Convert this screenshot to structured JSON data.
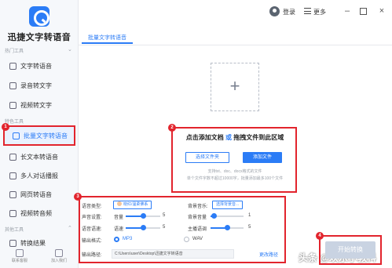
{
  "app": {
    "title": "迅捷文字转语音"
  },
  "sidebar": {
    "sections": [
      {
        "label": "热门工具"
      },
      {
        "label": "特色工具"
      },
      {
        "label": "其他工具"
      }
    ],
    "items": [
      {
        "label": "文字转语音"
      },
      {
        "label": "录音转文字"
      },
      {
        "label": "视频转文字"
      },
      {
        "label": "批量文字转语音"
      },
      {
        "label": "长文本转语音"
      },
      {
        "label": "多人对话播报"
      },
      {
        "label": "网页转语音"
      },
      {
        "label": "视频转音频"
      },
      {
        "label": "转换结果"
      }
    ],
    "badge": "1",
    "bottom": [
      {
        "label": "联系客服"
      },
      {
        "label": "加入我们"
      }
    ]
  },
  "topbar": {
    "login": "登录",
    "more": "更多"
  },
  "tab": {
    "label": "批量文字转语音"
  },
  "upload": {
    "badge": "2",
    "title_part1": "点击添加文档",
    "title_or": "或",
    "title_part2": "拖拽文件到此区域",
    "btn_folder": "选择文件夹",
    "btn_add": "添加文件",
    "hint1": "支持txt、doc、docx格式的文件",
    "hint2": "单个文件字数不超过10000字，批量添加最多100个文件"
  },
  "settings": {
    "badge": "3",
    "voice_type_label": "语音类型:",
    "voice_type_value": "晓红/温柔佛系",
    "bg_music_label": "背景音乐:",
    "bg_music_value": "选择背景音...",
    "sound_label": "声音设置:",
    "volume_label": "音量",
    "volume_value": "5",
    "volume_level": 0.5,
    "bg_volume_label": "背景音量",
    "bg_volume_value": "1",
    "bg_volume_level": 0.1,
    "speed_label": "语音语速:",
    "speed_sub": "语速",
    "speed_value": "5",
    "speed_level": 0.5,
    "pitch_label": "主播语调",
    "pitch_value": "5",
    "pitch_level": 0.5,
    "format_label": "输出格式:",
    "format_mp3": "MP3",
    "format_wav": "WAV",
    "path_label": "输出路径:",
    "path_value": "C:\\Users\\user\\Desktop\\迅捷文字转语音",
    "path_change": "更改路径"
  },
  "convert": {
    "badge": "4",
    "label": "开始转换"
  },
  "watermark": {
    "text": "头条 @欢乐小教科"
  }
}
